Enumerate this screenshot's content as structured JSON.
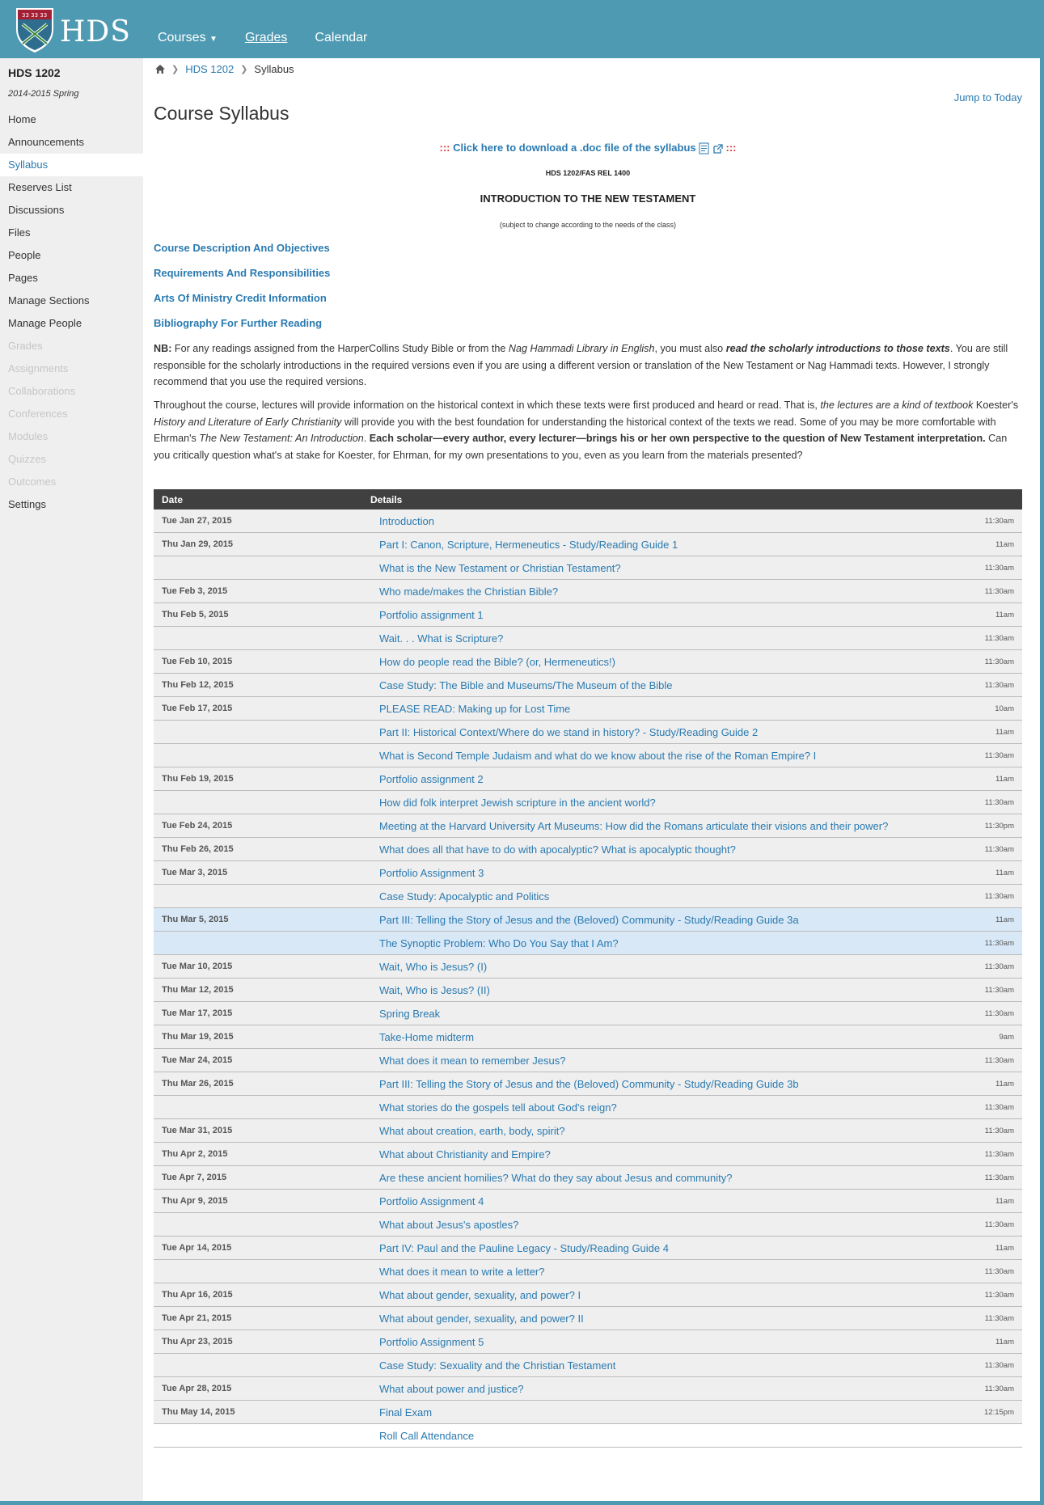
{
  "header": {
    "logo_text": "HDS",
    "nav": {
      "courses": "Courses",
      "grades": "Grades",
      "calendar": "Calendar"
    },
    "colors": {
      "header_bg": "#4e9ab2",
      "link": "#2a7ab0"
    }
  },
  "sidebar": {
    "course_code": "HDS 1202",
    "term": "2014-2015 Spring",
    "items": [
      {
        "label": "Home",
        "state": "normal"
      },
      {
        "label": "Announcements",
        "state": "normal"
      },
      {
        "label": "Syllabus",
        "state": "active"
      },
      {
        "label": "Reserves List",
        "state": "normal"
      },
      {
        "label": "Discussions",
        "state": "normal"
      },
      {
        "label": "Files",
        "state": "normal"
      },
      {
        "label": "People",
        "state": "normal"
      },
      {
        "label": "Pages",
        "state": "normal"
      },
      {
        "label": "Manage Sections",
        "state": "normal"
      },
      {
        "label": "Manage People",
        "state": "normal"
      },
      {
        "label": "Grades",
        "state": "disabled"
      },
      {
        "label": "Assignments",
        "state": "disabled"
      },
      {
        "label": "Collaborations",
        "state": "disabled"
      },
      {
        "label": "Conferences",
        "state": "disabled"
      },
      {
        "label": "Modules",
        "state": "disabled"
      },
      {
        "label": "Quizzes",
        "state": "disabled"
      },
      {
        "label": "Outcomes",
        "state": "disabled"
      },
      {
        "label": "Settings",
        "state": "normal"
      }
    ]
  },
  "breadcrumb": {
    "course": "HDS 1202",
    "current": "Syllabus"
  },
  "main": {
    "jump_to_today": "Jump to Today",
    "title": "Course Syllabus",
    "download_link": "Click here to download a .doc file of the syllabus",
    "download_dots": ":::",
    "code_line": "HDS 1202/FAS REL 1400",
    "course_title": "INTRODUCTION TO THE NEW TESTAMENT",
    "subject_note": "(subject to change according to the needs of the class)",
    "sections": [
      "Course Description And Objectives",
      "Requirements And Responsibilities",
      "Arts Of Ministry Credit Information",
      "Bibliography For Further Reading"
    ],
    "nb_para": {
      "nb": "NB:",
      "t1": " For any readings assigned from the HarperCollins Study Bible or from the ",
      "i1": "Nag Hammadi Library in English",
      "t2": ", you must also ",
      "b1": "read the scholarly introductions to those texts",
      "t3": ". You are still responsible for the scholarly introductions in the required versions even if you are using a different version or translation of the New Testament or Nag Hammadi texts. However, I strongly recommend that you use the required versions."
    },
    "course_para": {
      "t1": "Throughout the course, lectures will provide information on the historical context in which these texts were first produced and heard or read. That is, ",
      "i1": "the lectures are a kind of textbook",
      "t2": " Koester's ",
      "i2": "History and Literature of Early Christianity",
      "t3": " will provide you with the best foundation for understanding the historical context of the texts we read. Some of you may be more comfortable with Ehrman's ",
      "i3": "The New Testament: An Introduction",
      "t4": ". ",
      "b1": "Each scholar—every author, every lecturer—brings his or her own perspective to the question of New Testament interpretation.",
      "t5": " Can you critically question what's at stake for Koester, for Ehrman, for my own presentations to you, even as you learn from the materials presented?"
    }
  },
  "schedule": {
    "headers": {
      "date": "Date",
      "details": "Details"
    },
    "rows": [
      {
        "date": "Tue Jan 27, 2015",
        "title": "Introduction",
        "time": "11:30am"
      },
      {
        "date": "Thu Jan 29, 2015",
        "title": "Part I: Canon, Scripture, Hermeneutics - Study/Reading Guide 1",
        "time": "11am"
      },
      {
        "date": "",
        "title": "What is the New Testament or Christian Testament?",
        "time": "11:30am"
      },
      {
        "date": "Tue Feb 3, 2015",
        "title": "Who made/makes the Christian Bible?",
        "time": "11:30am"
      },
      {
        "date": "Thu Feb 5, 2015",
        "title": "Portfolio assignment 1",
        "time": "11am"
      },
      {
        "date": "",
        "title": "Wait. . . What is Scripture?",
        "time": "11:30am"
      },
      {
        "date": "Tue Feb 10, 2015",
        "title": "How do people read the Bible? (or, Hermeneutics!)",
        "time": "11:30am"
      },
      {
        "date": "Thu Feb 12, 2015",
        "title": "Case Study: The Bible and Museums/The Museum of the Bible",
        "time": "11:30am"
      },
      {
        "date": "Tue Feb 17, 2015",
        "title": "PLEASE READ: Making up for Lost Time",
        "time": "10am"
      },
      {
        "date": "",
        "title": "Part II: Historical Context/Where do we stand in history? - Study/Reading Guide 2",
        "time": "11am"
      },
      {
        "date": "",
        "title": "What is Second Temple Judaism and what do we know about the rise of the Roman Empire? I",
        "time": "11:30am"
      },
      {
        "date": "Thu Feb 19, 2015",
        "title": "Portfolio assignment 2",
        "time": "11am"
      },
      {
        "date": "",
        "title": "How did folk interpret Jewish scripture in the ancient world?",
        "time": "11:30am"
      },
      {
        "date": "Tue Feb 24, 2015",
        "title": "Meeting at the Harvard University Art Museums: How did the Romans articulate their visions and their power?",
        "time": "11:30pm"
      },
      {
        "date": "Thu Feb 26, 2015",
        "title": "What does all that have to do with apocalyptic? What is apocalyptic thought?",
        "time": "11:30am"
      },
      {
        "date": "Tue Mar 3, 2015",
        "title": "Portfolio Assignment 3",
        "time": "11am"
      },
      {
        "date": "",
        "title": "Case Study: Apocalyptic and Politics",
        "time": "11:30am"
      },
      {
        "date": "Thu Mar 5, 2015",
        "title": "Part III: Telling the Story of Jesus and the (Beloved) Community - Study/Reading Guide 3a",
        "time": "11am",
        "hl": true
      },
      {
        "date": "",
        "title": "The Synoptic Problem: Who Do You Say that I Am?",
        "time": "11:30am",
        "hl": true
      },
      {
        "date": "Tue Mar 10, 2015",
        "title": "Wait, Who is Jesus? (I)",
        "time": "11:30am"
      },
      {
        "date": "Thu Mar 12, 2015",
        "title": "Wait, Who is Jesus? (II)",
        "time": "11:30am"
      },
      {
        "date": "Tue Mar 17, 2015",
        "title": "Spring Break",
        "time": "11:30am"
      },
      {
        "date": "Thu Mar 19, 2015",
        "title": "Take-Home midterm",
        "time": "9am"
      },
      {
        "date": "Tue Mar 24, 2015",
        "title": "What does it mean to remember Jesus?",
        "time": "11:30am"
      },
      {
        "date": "Thu Mar 26, 2015",
        "title": "Part III: Telling the Story of Jesus and the (Beloved) Community - Study/Reading Guide 3b",
        "time": "11am"
      },
      {
        "date": "",
        "title": "What stories do the gospels tell about God's reign?",
        "time": "11:30am"
      },
      {
        "date": "Tue Mar 31, 2015",
        "title": "What about creation, earth, body, spirit?",
        "time": "11:30am"
      },
      {
        "date": "Thu Apr 2, 2015",
        "title": "What about Christianity and Empire?",
        "time": "11:30am"
      },
      {
        "date": "Tue Apr 7, 2015",
        "title": "Are these ancient homilies? What do they say about Jesus and community?",
        "time": "11:30am"
      },
      {
        "date": "Thu Apr 9, 2015",
        "title": "Portfolio Assignment 4",
        "time": "11am"
      },
      {
        "date": "",
        "title": "What about Jesus's apostles?",
        "time": "11:30am"
      },
      {
        "date": "Tue Apr 14, 2015",
        "title": "Part IV: Paul and the Pauline Legacy - Study/Reading Guide 4",
        "time": "11am"
      },
      {
        "date": "",
        "title": "What does it mean to write a letter?",
        "time": "11:30am"
      },
      {
        "date": "Thu Apr 16, 2015",
        "title": "What about gender, sexuality, and power? I",
        "time": "11:30am"
      },
      {
        "date": "Tue Apr 21, 2015",
        "title": "What about gender, sexuality, and power? II",
        "time": "11:30am"
      },
      {
        "date": "Thu Apr 23, 2015",
        "title": "Portfolio Assignment 5",
        "time": "11am"
      },
      {
        "date": "",
        "title": "Case Study: Sexuality and the Christian Testament",
        "time": "11:30am"
      },
      {
        "date": "Tue Apr 28, 2015",
        "title": "What about power and justice?",
        "time": "11:30am"
      },
      {
        "date": "Thu May 14, 2015",
        "title": "Final Exam",
        "time": "12:15pm"
      },
      {
        "date": "",
        "title": "Roll Call Attendance",
        "time": "",
        "last": true
      }
    ]
  }
}
